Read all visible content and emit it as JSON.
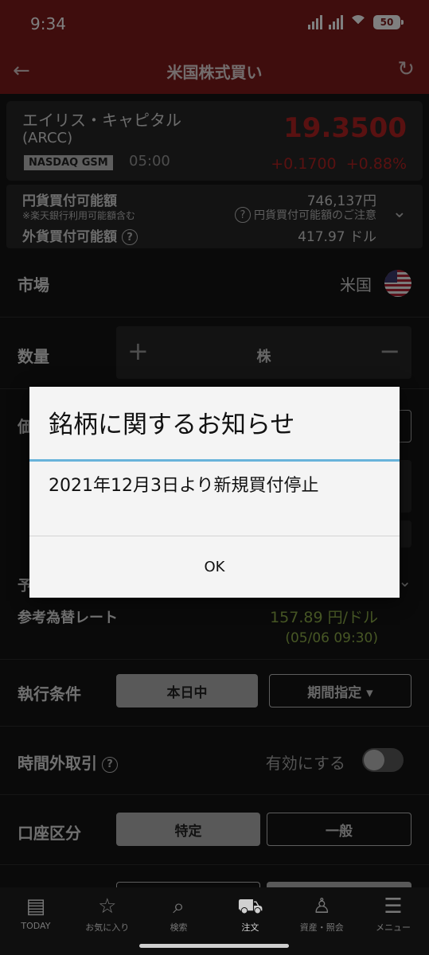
{
  "status_bar": {
    "time": "9:34",
    "battery": "50"
  },
  "header": {
    "title": "米国株式買い"
  },
  "stock": {
    "name": "エイリス・キャピタル",
    "ticker": "(ARCC)",
    "exchange": "NASDAQ GSM",
    "time": "05:00",
    "price": "19.3500",
    "change": "+0.1700",
    "change_pct": "+0.88%",
    "price_color": "#b22222"
  },
  "buying_power": {
    "yen_label": "円貨買付可能額",
    "yen_note": "※楽天銀行利用可能額含む",
    "yen_value": "746,137円",
    "caution": "円貨買付可能額のご注意",
    "usd_label": "外貨買付可能額",
    "usd_value": "417.97 ドル"
  },
  "form": {
    "market_label": "市場",
    "market_value": "米国",
    "qty_label": "数量",
    "qty_unit": "株",
    "price_label_partial": "価",
    "prediction_label_partial": "予",
    "fx_label": "参考為替レート",
    "fx_rate": "157.89 円/ドル",
    "fx_time": "(05/06 09:30)",
    "exec_label": "執行条件",
    "exec_options": [
      "本日中",
      "期間指定 ▾"
    ],
    "afterhours_label": "時間外取引",
    "afterhours_value": "有効にする",
    "account_label": "口座区分",
    "account_options": [
      "特定",
      "一般"
    ]
  },
  "dialog": {
    "title": "銘柄に関するお知らせ",
    "message": "2021年12月3日より新規買付停止",
    "ok": "OK"
  },
  "nav": [
    {
      "label": "TODAY",
      "icon": "document-icon"
    },
    {
      "label": "お気に入り",
      "icon": "star-icon"
    },
    {
      "label": "検索",
      "icon": "search-icon"
    },
    {
      "label": "注文",
      "icon": "cart-icon"
    },
    {
      "label": "資産・照会",
      "icon": "person-icon"
    },
    {
      "label": "メニュー",
      "icon": "menu-icon"
    }
  ],
  "colors": {
    "header": "#7f1a1a",
    "accent_rule": "#68b3da",
    "fx_green": "#8fae4a"
  }
}
